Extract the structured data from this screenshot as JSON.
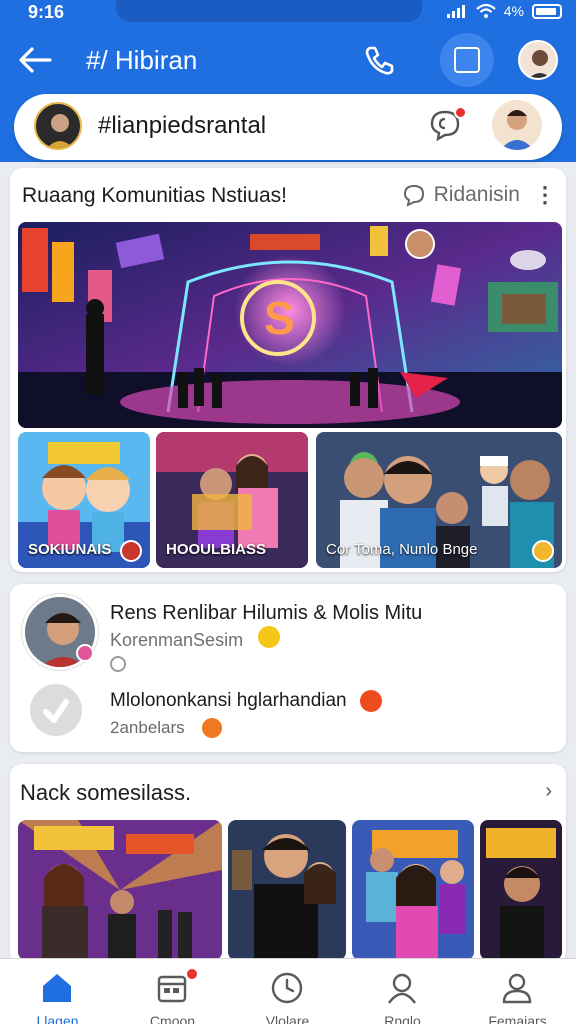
{
  "status_bar": {
    "time": "9:16",
    "battery": "4%"
  },
  "app_bar": {
    "title": "#/ Hibiran"
  },
  "search": {
    "value": "#lianpiedsrantal"
  },
  "community_card": {
    "title": "Ruaang Komunitias Nstiuas!",
    "action_label": "Ridanisin",
    "thumbnails": [
      {
        "label": "SOKIUNAIS"
      },
      {
        "label": "HOOULBIASS"
      },
      {
        "label": "Cor Toma, Nunlo Bnge"
      }
    ]
  },
  "post_card": {
    "title": "Rens Renlibar Hilumis & Molis Mitu",
    "subtitle": "KorenmanSesim",
    "reply_title": "Mlolononkansi hglarhandian",
    "reply_subtitle": "2anbelars"
  },
  "section_card": {
    "title": "Nack somesilass."
  },
  "bottom_nav": {
    "items": [
      {
        "label": "Llagen",
        "icon": "home-icon"
      },
      {
        "label": "Cmoon",
        "icon": "calendar-icon"
      },
      {
        "label": "Vlolare",
        "icon": "clock-icon"
      },
      {
        "label": "Rnglo",
        "icon": "people-icon"
      },
      {
        "label": "Femaiars",
        "icon": "profile-icon"
      }
    ]
  },
  "colors": {
    "primary": "#1f6fe0",
    "badge": "#e7322b"
  }
}
